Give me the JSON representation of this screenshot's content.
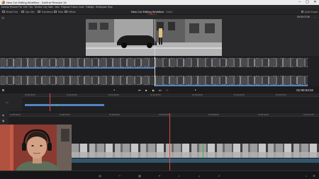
{
  "window": {
    "title": "New Cut Editing Workflow - DaVinci Resolve 16",
    "controls": [
      "–",
      "▢",
      "✕"
    ]
  },
  "menu": {
    "items": [
      "DaVinci Resolve",
      "File",
      "Edit",
      "Trim",
      "Timeline",
      "Clip",
      "Mark",
      "View",
      "Playback",
      "Fusion",
      "Color",
      "Fairlight",
      "Workspace",
      "Help"
    ]
  },
  "toolbar": {
    "left_buttons": [
      "Media Pool",
      "Sync Bin",
      "Transitions",
      "Titles",
      "Effects"
    ],
    "project_name": "New Cut Editing Workflow",
    "project_status": "Edited",
    "project_timeline": "Timeline 1",
    "right_button": "Quick Export"
  },
  "viewer": {
    "timecode": "00:00:07:06"
  },
  "transport": {
    "timecode": "01:00:04:02"
  },
  "upper_timeline": {
    "ruler_labels": [
      "01:00:00:00",
      "01:00:30:00",
      "01:01:00:00",
      "01:01:30:00",
      "01:02:00:00",
      "01:02:30:00",
      "01:03:00:00"
    ]
  },
  "lower_timeline": {
    "ruler_labels": [
      "01:00:00:00",
      "01:00:02:00",
      "01:00:04:00",
      "01:00:06:00",
      "01:00:08:00",
      "01:00:10:00",
      "01:00:12:00"
    ]
  },
  "page_tabs": {
    "items": [
      "media-icon",
      "cut-icon",
      "edit-icon",
      "fusion-icon",
      "color-icon",
      "fairlight-icon",
      "deliver-icon"
    ],
    "active": "cut-icon"
  },
  "colors": {
    "accent": "#e0483c",
    "clip_blue": "#4f86c2",
    "clip_green": "#3bb84a"
  }
}
